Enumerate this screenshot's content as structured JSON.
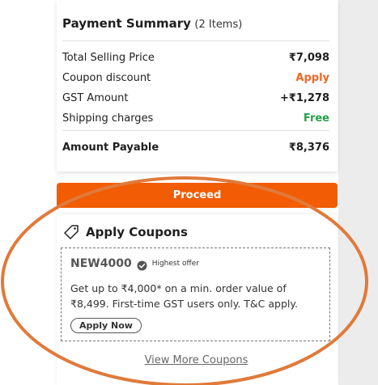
{
  "summary": {
    "title": "Payment Summary",
    "count": "(2 Items)",
    "rows": [
      {
        "label": "Total Selling Price",
        "value": "₹7,098"
      },
      {
        "label": "Coupon discount",
        "value": "Apply"
      },
      {
        "label": "GST Amount",
        "value": "+₹1,278"
      },
      {
        "label": "Shipping charges",
        "value": "Free"
      }
    ],
    "total": {
      "label": "Amount Payable",
      "value": "₹8,376"
    }
  },
  "proceed_label": "Proceed",
  "coupons": {
    "header": "Apply Coupons",
    "tag_icon": "tag-icon",
    "coupon": {
      "code": "NEW4000",
      "badge_icon": "verified-check-icon",
      "badge": "Highest offer",
      "description": "Get up to ₹4,000* on a min. order value of ₹8,499. First-time GST users only. T&C apply.",
      "apply_label": "Apply Now"
    },
    "view_more": "View More Coupons"
  },
  "colors": {
    "accent": "#f25c05",
    "coupon_apply": "#f26522",
    "free": "#25a244",
    "annotation_ring": "#e07a3a"
  }
}
